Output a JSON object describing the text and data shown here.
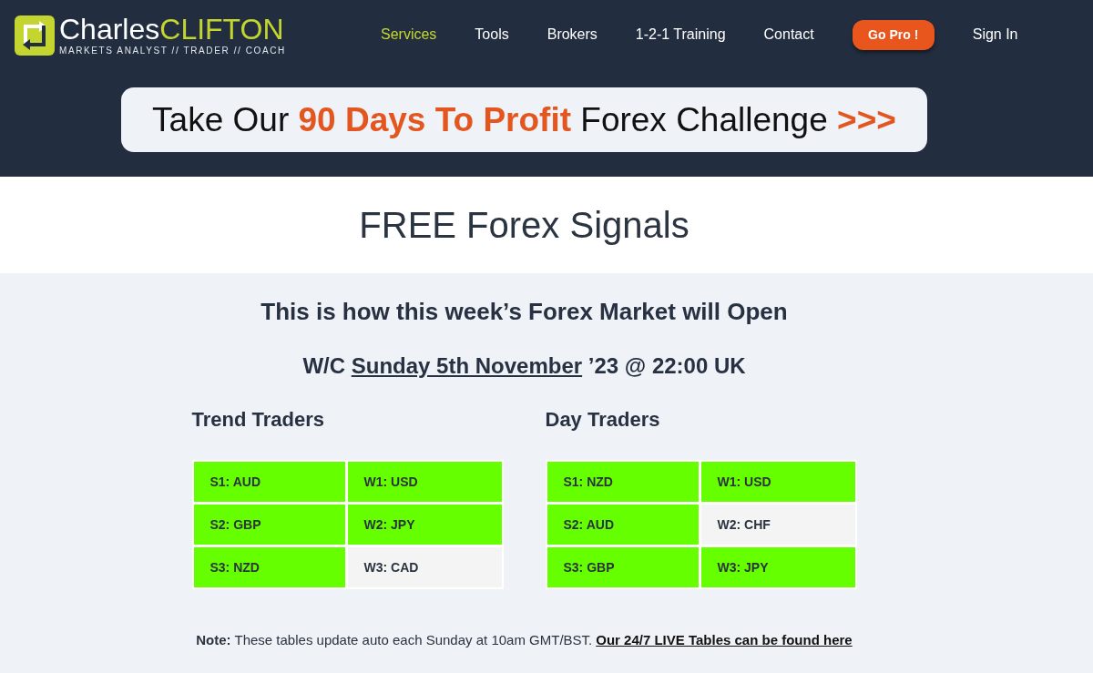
{
  "header": {
    "logo": {
      "first_name": "Charles",
      "last_name": "CLIFTON",
      "tagline": "MARKETS ANALYST // TRADER // COACH"
    },
    "nav": [
      {
        "label": "Services",
        "selected": true
      },
      {
        "label": "Tools",
        "selected": false
      },
      {
        "label": "Brokers",
        "selected": false
      },
      {
        "label": "1-2-1 Training",
        "selected": false
      },
      {
        "label": "Contact",
        "selected": false
      }
    ],
    "cta_button": "Go Pro !",
    "sign_in": "Sign In"
  },
  "banner": "Take Our **90 Days To Profit** Forex Challenge **>>>**",
  "page_title": "FREE Forex Signals",
  "signals": {
    "heading": "This is how this week’s Forex Market will Open",
    "week": {
      "prefix": "W/C",
      "date": "Sunday 5th November",
      "suffix": "’23 @ 22:00 UK"
    },
    "tables": [
      {
        "title": "Trend Traders",
        "cells": [
          {
            "text": "S1: AUD",
            "highlighted": true
          },
          {
            "text": "W1: USD",
            "highlighted": true
          },
          {
            "text": "S2: GBP",
            "highlighted": true
          },
          {
            "text": "W2: JPY",
            "highlighted": true
          },
          {
            "text": "S3: NZD",
            "highlighted": true
          },
          {
            "text": "W3: CAD",
            "highlighted": false
          }
        ]
      },
      {
        "title": "Day Traders",
        "cells": [
          {
            "text": "S1: NZD",
            "highlighted": true
          },
          {
            "text": "W1: USD",
            "highlighted": true
          },
          {
            "text": "S2: AUD",
            "highlighted": true
          },
          {
            "text": "W2: CHF",
            "highlighted": false
          },
          {
            "text": "S3: GBP",
            "highlighted": true
          },
          {
            "text": "W3: JPY",
            "highlighted": true
          }
        ]
      }
    ],
    "note": {
      "text": "**Note:** These tables update auto each Sunday at 10am GMT/BST.",
      "link": "Our 24/7 LIVE Tables can be found here"
    }
  }
}
